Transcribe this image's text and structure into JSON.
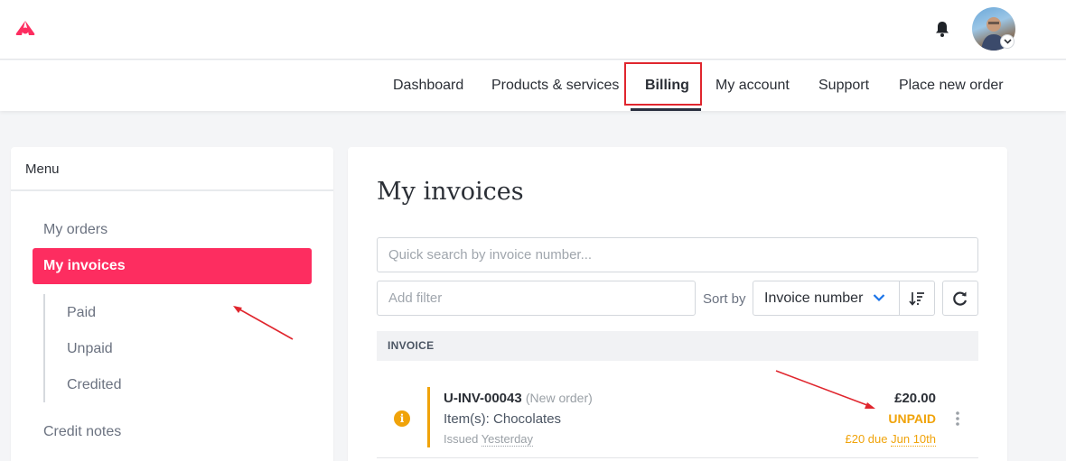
{
  "header": {
    "logo_icon": "brand-logo-icon",
    "notification_icon": "bell-icon",
    "avatar_alt": "user-avatar"
  },
  "nav": {
    "items": [
      {
        "label": "Dashboard"
      },
      {
        "label": "Products & services"
      },
      {
        "label": "Billing",
        "active": true
      },
      {
        "label": "My account"
      },
      {
        "label": "Support"
      },
      {
        "label": "Place new order"
      }
    ]
  },
  "sidebar": {
    "title": "Menu",
    "items": [
      {
        "label": "My orders"
      },
      {
        "label": "My invoices",
        "active": true
      },
      {
        "label": "Credit notes"
      }
    ],
    "subitems": [
      {
        "label": "Paid"
      },
      {
        "label": "Unpaid"
      },
      {
        "label": "Credited"
      }
    ]
  },
  "main": {
    "title": "My invoices",
    "search_placeholder": "Quick search by invoice number...",
    "filter_placeholder": "Add filter",
    "sort_label": "Sort by",
    "sort_value": "Invoice number",
    "table_header": "INVOICE",
    "invoices": [
      {
        "number": "U-INV-00043",
        "tag": "(New order)",
        "items_prefix": "Item(s):",
        "items": "Chocolates",
        "issued_prefix": "Issued",
        "issued": "Yesterday",
        "amount": "£20.00",
        "status": "UNPAID",
        "due_prefix": "£20 due",
        "due_date": "Jun 10th"
      }
    ]
  },
  "colors": {
    "accent": "#fd2d60",
    "warning": "#f0a30a",
    "annotation": "#e0262e"
  }
}
